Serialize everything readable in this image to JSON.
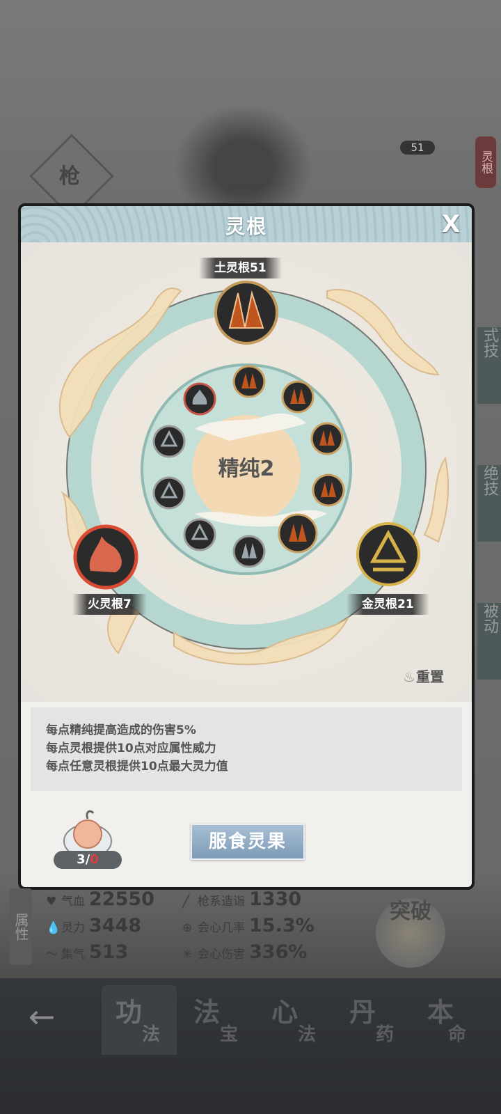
{
  "background": {
    "weapon_label": "枪",
    "level": "51",
    "lingen_tag": "灵根",
    "side_tabs": [
      "式技",
      "绝技",
      "被动"
    ]
  },
  "modal": {
    "title": "灵根",
    "close_label": "X",
    "roots": {
      "earth": "土灵根51",
      "fire": "火灵根7",
      "metal": "金灵根21"
    },
    "purity": "精纯2",
    "reset_label": "重置",
    "info_lines": [
      "每点精纯提高造成的伤害5%",
      "每点灵根提供10点对应属性威力",
      "每点任意灵根提供10点最大灵力值"
    ],
    "fruit_count_a": "3",
    "fruit_count_sep": "/",
    "fruit_count_b": "0",
    "eat_button": "服食灵果"
  },
  "stats": {
    "tag": "属性",
    "hp_label": "气血",
    "hp": "22550",
    "mp_label": "灵力",
    "mp": "3448",
    "qi_label": "集气",
    "qi": "513",
    "spear_label": "枪系造诣",
    "spear": "1330",
    "crit_rate_label": "会心几率",
    "crit_rate": "15.3%",
    "crit_dmg_label": "会心伤害",
    "crit_dmg": "336%",
    "breakthrough": "突破"
  },
  "nav": {
    "back": "←",
    "items": [
      {
        "big": "功",
        "small": "法"
      },
      {
        "big": "法",
        "small": "宝"
      },
      {
        "big": "心",
        "small": "法"
      },
      {
        "big": "丹",
        "small": "药"
      },
      {
        "big": "本",
        "small": "命"
      }
    ]
  },
  "colors": {
    "earth": "#c0561f",
    "fire": "#d94a33",
    "metal": "#d7b24a",
    "water": "#9ba6ad",
    "ring": "#9fcdc6"
  }
}
